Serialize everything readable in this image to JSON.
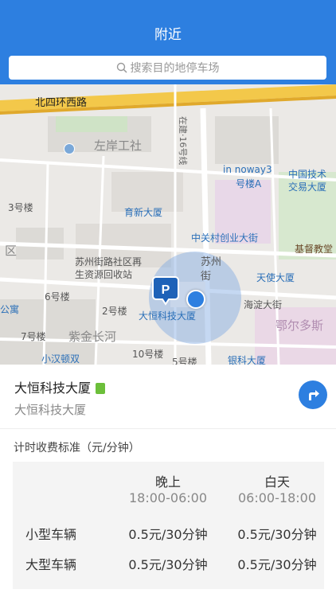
{
  "header": {
    "title": "附近"
  },
  "search": {
    "placeholder": "搜索目的地停车场",
    "icon": "search-icon"
  },
  "map": {
    "labels": {
      "road_north": "北四环西路",
      "zuoan": "左岸工社",
      "inn": "in noway3",
      "inn2": "号楼A",
      "zhongguo1": "中国技术",
      "zhongguo2": "交易大厦",
      "building3": "3号楼",
      "yuxin": "育新大厦",
      "zgc": "中关村创业大街",
      "jidu": "基督教堂",
      "district": "区",
      "sz1": "苏州街路社区再",
      "sz2": "生资源回收站",
      "szj": "苏州",
      "szj2": "街",
      "tianshi": "天使大厦",
      "building6": "6号楼",
      "building2": "2号楼",
      "daheng": "大恒科技大厦",
      "haidian": "海淀大街",
      "gongyu": "公寓",
      "eer": "鄂尔多斯",
      "building7": "7号楼",
      "zijin": "紫金长河",
      "xiaohan": "小汉顿双",
      "building10": "10号楼",
      "building5": "5号楼",
      "yinke": "银科大厦",
      "vertical_road": "在建·16号线"
    }
  },
  "place": {
    "name": "大恒科技大厦",
    "sub": "大恒科技大厦"
  },
  "fee": {
    "title": "计时收费标准（元/分钟）",
    "columns": [
      {
        "label": "晚上",
        "time": "18:00-06:00"
      },
      {
        "label": "白天",
        "time": "06:00-18:00"
      }
    ],
    "rows": [
      {
        "label": "小型车辆",
        "night": "0.5元/30分钟",
        "day": "0.5元/30分钟"
      },
      {
        "label": "大型车辆",
        "night": "0.5元/30分钟",
        "day": "0.5元/30分钟"
      }
    ]
  }
}
